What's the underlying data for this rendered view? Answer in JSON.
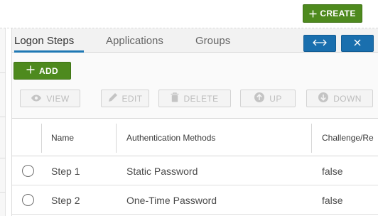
{
  "header": {
    "create_label": "CREATE"
  },
  "tabs": [
    {
      "label": "Logon Steps",
      "active": true
    },
    {
      "label": "Applications",
      "active": false
    },
    {
      "label": "Groups",
      "active": false
    }
  ],
  "toolbar": {
    "add_label": "ADD",
    "view_label": "VIEW",
    "edit_label": "EDIT",
    "delete_label": "DELETE",
    "up_label": "UP",
    "down_label": "DOWN"
  },
  "table": {
    "columns": [
      "Name",
      "Authentication Methods",
      "Challenge/Re"
    ],
    "rows": [
      {
        "name": "Step 1",
        "method": "Static Password",
        "challenge": "false"
      },
      {
        "name": "Step 2",
        "method": "One-Time Password",
        "challenge": "false"
      }
    ]
  },
  "colors": {
    "primary_green": "#4e8a1e",
    "primary_blue": "#1a6fae",
    "tab_underline": "#1f78b4",
    "disabled_text": "#bdbdbd"
  },
  "icons": [
    "plus-icon",
    "expand-horizontal-icon",
    "close-icon",
    "eye-icon",
    "pencil-icon",
    "trash-icon",
    "arrow-up-circle-icon",
    "arrow-down-circle-icon"
  ]
}
